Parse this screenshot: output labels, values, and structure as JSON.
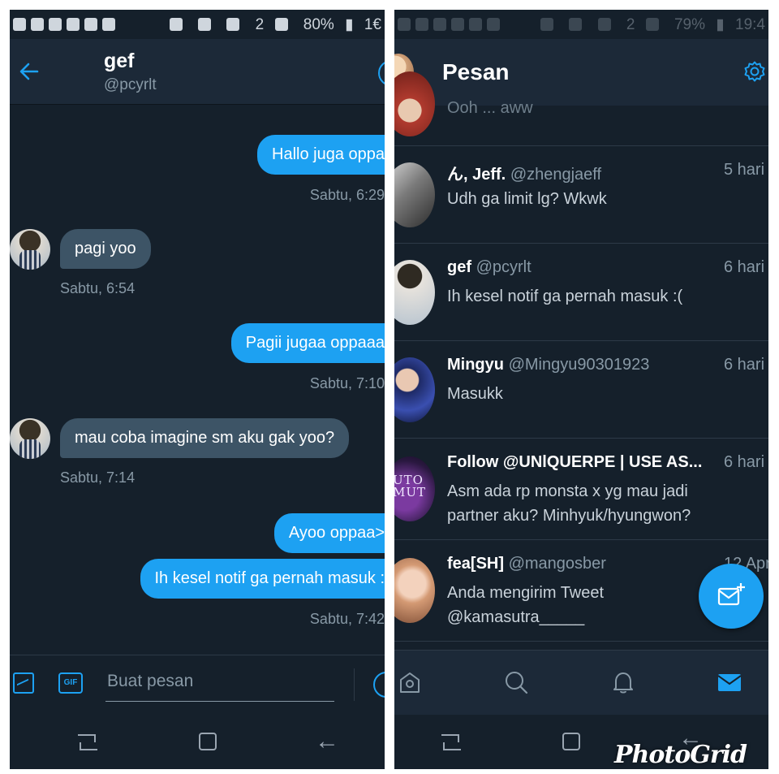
{
  "left": {
    "status": {
      "battery": "80%",
      "time": "1€",
      "sim": "2"
    },
    "chat": {
      "name": "gef",
      "handle": "@pcyrlt"
    },
    "messages": [
      {
        "dir": "out",
        "text": "Hallo juga oppa"
      },
      {
        "dir": "ts-out",
        "text": "Sabtu, 6:29"
      },
      {
        "dir": "in",
        "text": "pagi yoo"
      },
      {
        "dir": "ts-in",
        "text": "Sabtu, 6:54"
      },
      {
        "dir": "out",
        "text": "Pagii jugaa oppaaa"
      },
      {
        "dir": "ts-out",
        "text": "Sabtu, 7:10"
      },
      {
        "dir": "in",
        "text": "mau coba imagine sm aku gak yoo?"
      },
      {
        "dir": "ts-in",
        "text": "Sabtu, 7:14"
      },
      {
        "dir": "out",
        "text": "Ayoo oppaa>"
      },
      {
        "dir": "out",
        "text": "Ih kesel notif ga pernah masuk :"
      },
      {
        "dir": "ts-out",
        "text": "Sabtu, 7:42"
      }
    ],
    "composer": {
      "placeholder": "Buat pesan",
      "gif_label": "GIF"
    }
  },
  "right": {
    "status": {
      "battery": "79%",
      "time": "19:4",
      "sim": "2"
    },
    "title": "Pesan",
    "partial_text": "Ooh ... aww",
    "conversations": [
      {
        "name": "ん, Jeff.",
        "handle": "@zhengjaeff",
        "time": "5 hari",
        "line1": "Udh ga limit lg? Wkwk",
        "line2": ""
      },
      {
        "name": "gef",
        "handle": "@pcyrlt",
        "time": "6 hari",
        "line1": "Ih kesel notif ga pernah masuk :(",
        "line2": ""
      },
      {
        "name": "Mingyu",
        "handle": "@Mingyu90301923",
        "time": "6 hari",
        "line1": "Masukk",
        "line2": ""
      },
      {
        "name": "Follow @UNlQUERPE | USE AS...",
        "handle": "",
        "time": "6 hari",
        "line1": "Asm ada rp monsta x yg mau jadi",
        "line2": "partner aku? Minhyuk/hyungwon?"
      },
      {
        "name": "fea[SH]",
        "handle": "@mangosber",
        "time": "12 Apr",
        "line1": "Anda mengirim Tweet",
        "line2": "@kamasutra_____"
      }
    ],
    "avatar_text": {
      "follow": "UTO\nMUT"
    }
  },
  "watermark": "PhotoGrid",
  "colors": {
    "accent": "#1da1f2",
    "background": "#15202b",
    "header": "#1c2938",
    "incoming_bubble": "#3d5466"
  }
}
